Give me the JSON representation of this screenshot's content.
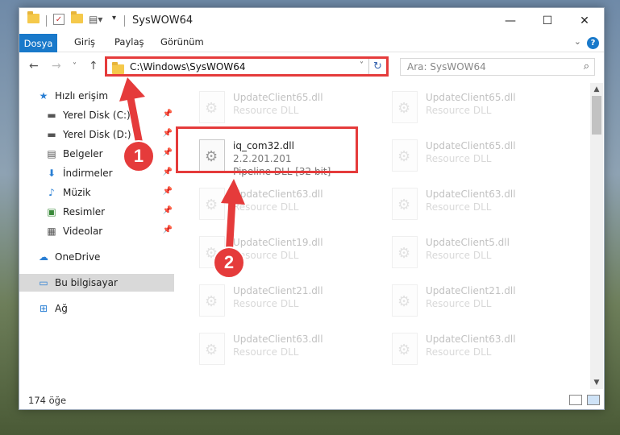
{
  "window": {
    "title": "SysWOW64",
    "minimize": "—",
    "maximize": "☐",
    "close": "✕"
  },
  "ribbon": {
    "tabs": [
      "Dosya",
      "Giriş",
      "Paylaş",
      "Görünüm"
    ],
    "help": "?"
  },
  "nav": {
    "back": "←",
    "forward": "→",
    "dropdown": "˅",
    "up": "↑",
    "address": "C:\\Windows\\SysWOW64",
    "address_dropdown": "˅",
    "refresh": "↻",
    "search_placeholder": "Ara: SysWOW64"
  },
  "sidebar": {
    "items": [
      {
        "label": "Hızlı erişim",
        "icon": "star-icon",
        "glyph": "★",
        "color": "#2a7fd4"
      },
      {
        "label": "Yerel Disk (C:)",
        "icon": "drive-icon",
        "glyph": "▬",
        "color": "#555"
      },
      {
        "label": "Yerel Disk (D:)",
        "icon": "drive-icon",
        "glyph": "▬",
        "color": "#555"
      },
      {
        "label": "Belgeler",
        "icon": "document-icon",
        "glyph": "▤",
        "color": "#555"
      },
      {
        "label": "İndirmeler",
        "icon": "download-icon",
        "glyph": "⬇",
        "color": "#2a7fd4"
      },
      {
        "label": "Müzik",
        "icon": "music-icon",
        "glyph": "♪",
        "color": "#2a7fd4"
      },
      {
        "label": "Resimler",
        "icon": "pictures-icon",
        "glyph": "▣",
        "color": "#3a8a3a"
      },
      {
        "label": "Videolar",
        "icon": "video-icon",
        "glyph": "▦",
        "color": "#555"
      },
      {
        "label": "OneDrive",
        "icon": "cloud-icon",
        "glyph": "☁",
        "color": "#2a7fd4"
      },
      {
        "label": "Bu bilgisayar",
        "icon": "computer-icon",
        "glyph": "▭",
        "color": "#2a7fd4"
      },
      {
        "label": "Ağ",
        "icon": "network-icon",
        "glyph": "⊞",
        "color": "#2a7fd4"
      }
    ]
  },
  "files": {
    "left": [
      {
        "name": "UpdateClient65.dll",
        "type": "Resource DLL"
      },
      {
        "name": "iq_com32.dll",
        "version": "2.2.201.201",
        "type": "Pipeline DLL [32 bit]"
      },
      {
        "name": "UpdateClient63.dll",
        "type": "Resource DLL"
      },
      {
        "name": "UpdateClient19.dll",
        "type": "Resource DLL"
      },
      {
        "name": "UpdateClient21.dll",
        "type": "Resource DLL"
      },
      {
        "name": "UpdateClient63.dll",
        "type": "Resource DLL"
      }
    ],
    "right": [
      {
        "name": "UpdateClient65.dll",
        "type": "Resource DLL"
      },
      {
        "name": "UpdateClient65.dll",
        "type": "Resource DLL"
      },
      {
        "name": "UpdateClient63.dll",
        "type": "Resource DLL"
      },
      {
        "name": "UpdateClient5.dll",
        "type": "Resource DLL"
      },
      {
        "name": "UpdateClient21.dll",
        "type": "Resource DLL"
      },
      {
        "name": "UpdateClient63.dll",
        "type": "Resource DLL"
      }
    ]
  },
  "status": {
    "count": "174 öğe"
  },
  "annotations": {
    "badge1": "1",
    "badge2": "2",
    "color": "#e53b3b"
  }
}
